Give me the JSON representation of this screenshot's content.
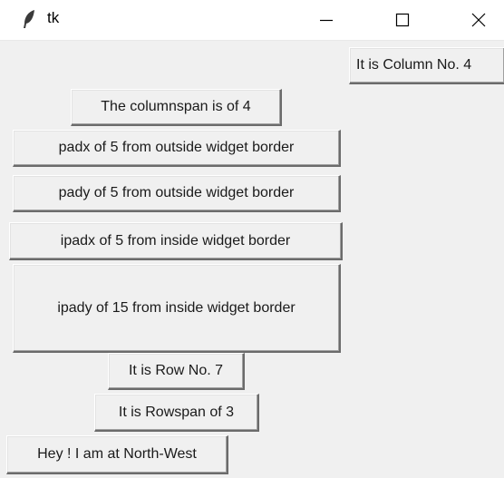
{
  "window": {
    "title": "tk",
    "icon": "feather-icon",
    "controls": {
      "minimize_icon": "minimize-icon",
      "maximize_icon": "maximize-icon",
      "close_icon": "close-icon"
    }
  },
  "buttons": {
    "column4": "It is Column No. 4",
    "columnspan": "The columnspan is of 4",
    "padx": "padx of 5 from outside widget border",
    "pady": "pady of 5 from outside widget border",
    "ipadx": "ipadx of 5 from inside widget border",
    "ipady": "ipady of 15 from inside widget border",
    "row7": "It is Row No. 7",
    "rowspan": "It is Rowspan of 3",
    "northwest": "Hey ! I am at North-West"
  }
}
